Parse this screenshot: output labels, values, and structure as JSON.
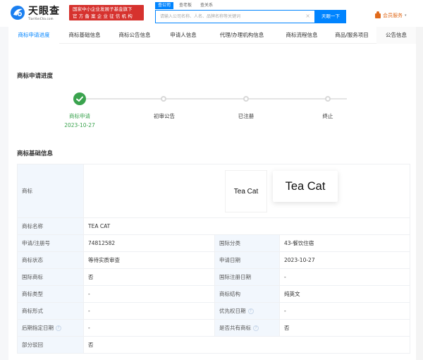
{
  "header": {
    "logo_cn": "天眼查",
    "logo_en": "TianYanCha.com",
    "badge_line1": "国家中小企业发展子基金旗下",
    "badge_line2": "官方备案企业征信机构",
    "search_tabs": [
      "查公司",
      "查老板",
      "查关系"
    ],
    "search_placeholder": "请输入公司名称、人名、品牌名称等关键词",
    "search_clear": "×",
    "search_button": "天眼一下",
    "vip_label": "会员服务",
    "vip_caret": "▾"
  },
  "tabs": [
    {
      "label": "商标申请进度",
      "active": true
    },
    {
      "label": "商标基础信息"
    },
    {
      "label": "商标公告信息"
    },
    {
      "label": "申请人信息"
    },
    {
      "label": "代理/办理机构信息"
    },
    {
      "label": "商标流程信息"
    },
    {
      "label": "商品/服务项目"
    },
    {
      "label": "公告信息"
    }
  ],
  "progress": {
    "title": "商标申请进度",
    "steps": [
      {
        "label": "商标申请",
        "date": "2023-10-27",
        "status": "done"
      },
      {
        "label": "初审公告",
        "date": "",
        "status": "pending"
      },
      {
        "label": "已注册",
        "date": "",
        "status": "pending"
      },
      {
        "label": "终止",
        "date": "",
        "status": "pending"
      }
    ]
  },
  "basic_info": {
    "title": "商标基础信息",
    "mark_label": "商标",
    "mark_text": "Tea Cat",
    "rows": [
      {
        "k1": "商标名称",
        "v1": "TEA CAT"
      },
      {
        "k1": "申请/注册号",
        "v1": "74812582",
        "k2": "国际分类",
        "v2": "43-餐饮住宿"
      },
      {
        "k1": "商标状态",
        "v1": "等待实质审查",
        "k2": "申请日期",
        "v2": "2023-10-27"
      },
      {
        "k1": "国际商标",
        "v1": "否",
        "k2": "国际注册日期",
        "v2": "-"
      },
      {
        "k1": "商标类型",
        "v1": "-",
        "k2": "商标结构",
        "v2": "纯英文"
      },
      {
        "k1": "商标形式",
        "v1": "-",
        "k2": "优先权日期",
        "v2": "-"
      },
      {
        "k1": "后期指定日期",
        "v1": "-",
        "k2": "是否共有商标",
        "v2": "否"
      },
      {
        "k1": "部分驳回",
        "v1": "否"
      }
    ],
    "help_glyph": "?"
  }
}
